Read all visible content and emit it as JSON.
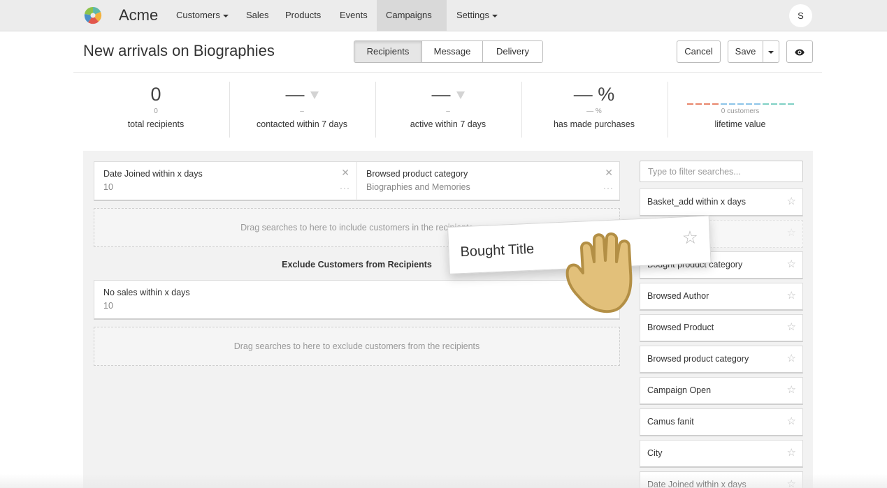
{
  "nav": {
    "brand": "Acme",
    "items": [
      {
        "label": "Customers",
        "dropdown": true
      },
      {
        "label": "Sales",
        "dropdown": false
      },
      {
        "label": "Products",
        "dropdown": false
      },
      {
        "label": "Events",
        "dropdown": false
      },
      {
        "label": "Campaigns",
        "dropdown": true,
        "active": true
      },
      {
        "label": "Settings",
        "dropdown": true
      }
    ],
    "avatar_initial": "S"
  },
  "header": {
    "title": "New arrivals on Biographies",
    "tabs": [
      {
        "label": "Recipients",
        "active": true
      },
      {
        "label": "Message",
        "active": false
      },
      {
        "label": "Delivery",
        "active": false
      }
    ],
    "cancel_label": "Cancel",
    "save_label": "Save",
    "preview_icon": "eye-icon"
  },
  "stats": [
    {
      "big": "0",
      "small": "0",
      "label": "total recipients"
    },
    {
      "big": "—",
      "small": "–",
      "label": "contacted within 7 days",
      "trend_icon": "triangle-down-icon"
    },
    {
      "big": "—",
      "small": "–",
      "label": "active within 7 days",
      "trend_icon": "triangle-down-icon"
    },
    {
      "big": "— %",
      "small": "— %",
      "label": "has made purchases"
    },
    {
      "small": "0 customers",
      "label": "lifetime value"
    }
  ],
  "ltv_colors": [
    "#e8856b",
    "#e8856b",
    "#e8856b",
    "#e8856b",
    "#8cc4e8",
    "#8cc4e8",
    "#8cc4e8",
    "#8cc4e8",
    "#8cc4e8",
    "#7fd0c4",
    "#7fd0c4",
    "#7fd0c4",
    "#7fd0c4"
  ],
  "include": {
    "criteria": [
      {
        "title": "Date Joined within x days",
        "value": "10"
      },
      {
        "title": "Browsed product category",
        "value": "Biographies and Memories"
      }
    ],
    "dropzone_text": "Drag searches to here to include customers in the recipients"
  },
  "exclude": {
    "heading": "Exclude Customers from Recipients",
    "criteria": [
      {
        "title": "No sales within x days",
        "value": "10"
      }
    ],
    "dropzone_text": "Drag searches to here to exclude customers from the recipients"
  },
  "sidebar": {
    "filter_placeholder": "Type to filter searches...",
    "items": [
      {
        "label": "Basket_add within x days"
      },
      {
        "label": ""
      },
      {
        "label": "Bought product category"
      },
      {
        "label": "Browsed Author"
      },
      {
        "label": "Browsed Product"
      },
      {
        "label": "Browsed product category"
      },
      {
        "label": "Campaign Open"
      },
      {
        "label": "Camus fanit"
      },
      {
        "label": "City"
      },
      {
        "label": "Date Joined within x days"
      }
    ]
  },
  "drag": {
    "label": "Bought Title"
  },
  "colors": {
    "nav_bg": "#ececec",
    "panel_bg": "#f2f2f2",
    "hand": "#e2c07a"
  }
}
